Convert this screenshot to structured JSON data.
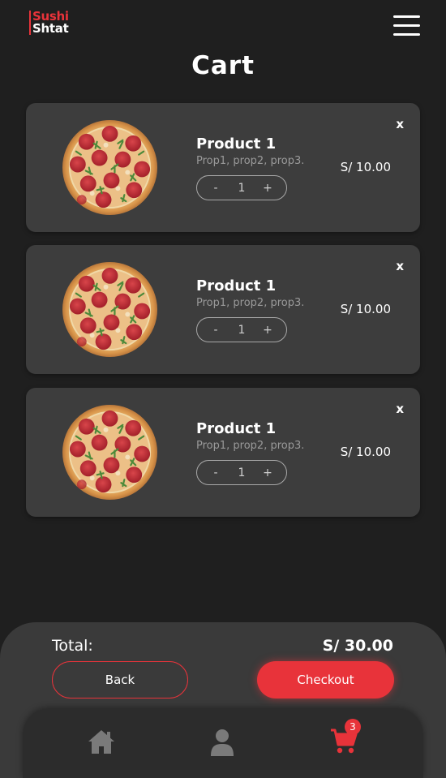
{
  "header": {
    "logo_line1": "Sushi",
    "logo_line2": "Shtat"
  },
  "page": {
    "title": "Cart"
  },
  "cart_items": [
    {
      "name": "Product 1",
      "description": "Prop1, prop2, prop3.",
      "quantity": "1",
      "price": "S/ 10.00",
      "decrement_label": "-",
      "increment_label": "+",
      "remove_label": "x"
    },
    {
      "name": "Product 1",
      "description": "Prop1, prop2, prop3.",
      "quantity": "1",
      "price": "S/ 10.00",
      "decrement_label": "-",
      "increment_label": "+",
      "remove_label": "x"
    },
    {
      "name": "Product 1",
      "description": "Prop1, prop2, prop3.",
      "quantity": "1",
      "price": "S/ 10.00",
      "decrement_label": "-",
      "increment_label": "+",
      "remove_label": "x"
    }
  ],
  "summary": {
    "total_label": "Total:",
    "total_value": "S/ 30.00",
    "back_label": "Back",
    "checkout_label": "Checkout"
  },
  "nav": {
    "cart_badge": "3",
    "icons": [
      "home-icon",
      "user-icon",
      "cart-icon"
    ]
  },
  "colors": {
    "accent": "#e8333a",
    "background": "#1f1f1f",
    "card": "#3d3d3d"
  }
}
